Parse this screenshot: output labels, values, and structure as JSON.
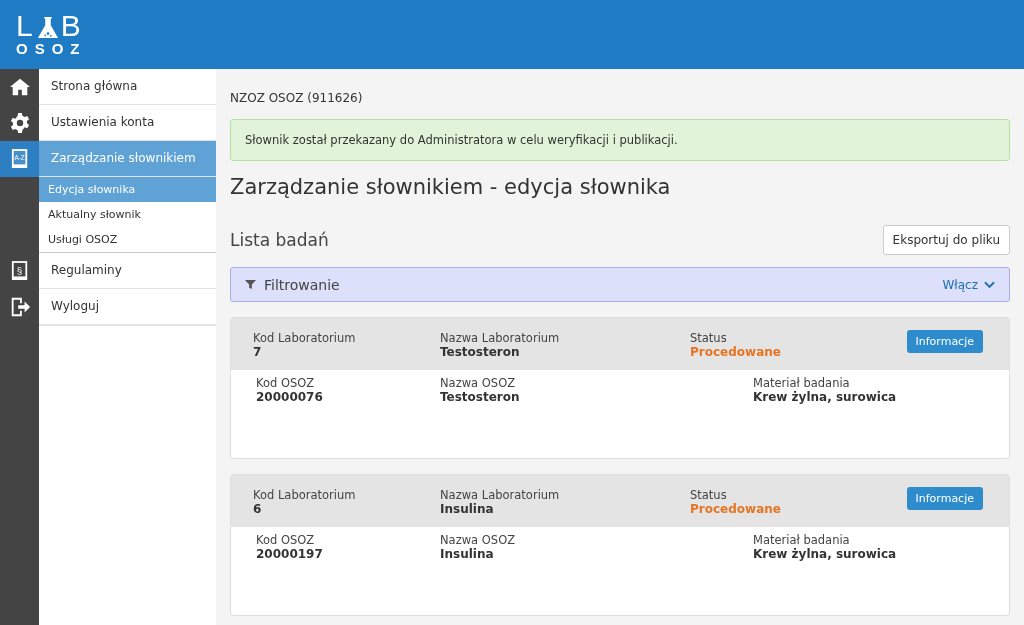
{
  "logo": {
    "before": "L",
    "after": "B",
    "subtitle": "OSOZ"
  },
  "sidebar": {
    "items": [
      {
        "label": "Strona główna",
        "selected": false
      },
      {
        "label": "Ustawienia konta",
        "selected": false
      },
      {
        "label": "Zarządzanie słownikiem",
        "icon_text": "A-Z",
        "selected": true,
        "children": [
          {
            "label": "Edycja słownika",
            "selected": true
          },
          {
            "label": "Aktualny słownik",
            "selected": false
          },
          {
            "label": "Usługi OSOZ",
            "selected": false
          }
        ]
      },
      {
        "label": "Regulaminy",
        "icon_text": "§",
        "selected": false
      },
      {
        "label": "Wyloguj",
        "selected": false
      }
    ]
  },
  "org": "NZOZ OSOZ (911626)",
  "alert": "Słownik został przekazany do Administratora w celu weryfikacji i publikacji.",
  "page_title": "Zarządzanie słownikiem - edycja słownika",
  "section_title": "Lista badań",
  "export_button": "Eksportuj do pliku",
  "filter": {
    "label": "Filtrowanie",
    "toggle": "Włącz",
    "expanded": false
  },
  "records": [
    {
      "header": [
        {
          "label": "Kod Laboratorium",
          "value": "7"
        },
        {
          "label": "Nazwa Laboratorium",
          "value": "Testosteron"
        },
        {
          "label": "Status",
          "value": "Procedowane"
        }
      ],
      "button": "Informacje",
      "body": [
        {
          "label": "Kod OSOZ",
          "value": "20000076"
        },
        {
          "label": "Nazwa OSOZ",
          "value": "Testosteron"
        },
        {
          "label": "Materiał badania",
          "value": "Krew żylna, surowica"
        }
      ]
    },
    {
      "header": [
        {
          "label": "Kod Laboratorium",
          "value": "6"
        },
        {
          "label": "Nazwa Laboratorium",
          "value": "Insulina"
        },
        {
          "label": "Status",
          "value": "Procedowane"
        }
      ],
      "button": "Informacje",
      "body": [
        {
          "label": "Kod OSOZ",
          "value": "20000197"
        },
        {
          "label": "Nazwa OSOZ",
          "value": "Insulina"
        },
        {
          "label": "Materiał badania",
          "value": "Krew żylna, surowica"
        }
      ]
    }
  ]
}
